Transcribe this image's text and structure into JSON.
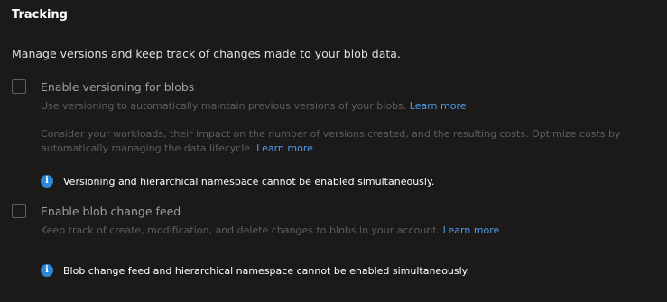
{
  "section": {
    "title": "Tracking",
    "description": "Manage versions and keep track of changes made to your blob data."
  },
  "versioning": {
    "label": "Enable versioning for blobs",
    "checked": false,
    "help1": "Use versioning to automatically maintain previous versions of your blobs.",
    "help1_link": "Learn more",
    "help2": "Consider your workloads, their impact on the number of versions created, and the resulting costs. Optimize costs by automatically managing the data lifecycle.",
    "help2_link": "Learn more",
    "info_icon": "info-icon",
    "info": "Versioning and hierarchical namespace cannot be enabled simultaneously."
  },
  "change_feed": {
    "label": "Enable blob change feed",
    "checked": false,
    "help": "Keep track of create, modification, and delete changes to blobs in your account.",
    "help_link": "Learn more",
    "info_icon": "info-icon",
    "info": "Blob change feed and hierarchical namespace cannot be enabled simultaneously."
  },
  "colors": {
    "background": "#1b1a19",
    "link": "#4f9bea",
    "info_icon": "#2b88d8"
  }
}
